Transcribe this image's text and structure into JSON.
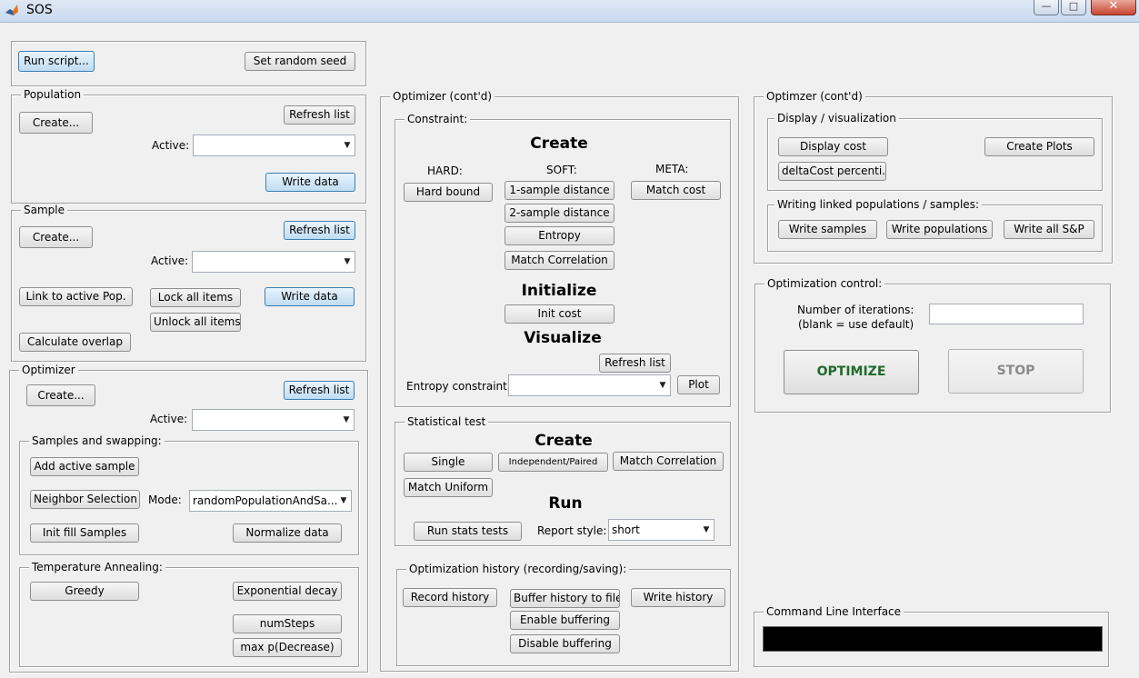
{
  "window": {
    "title": "SOS",
    "controls": {
      "minimize": "—",
      "maximize": "□",
      "close": "✕"
    }
  },
  "top": {
    "run_script": "Run script...",
    "set_seed": "Set random seed"
  },
  "population": {
    "title": "Population",
    "create": "Create...",
    "refresh": "Refresh list",
    "active_label": "Active:",
    "active_value": "",
    "write": "Write data"
  },
  "sample": {
    "title": "Sample",
    "create": "Create...",
    "refresh": "Refresh list",
    "active_label": "Active:",
    "active_value": "",
    "link": "Link to active Pop.",
    "lock": "Lock all items",
    "write": "Write data",
    "unlock": "Unlock all items",
    "overlap": "Calculate overlap"
  },
  "optimizer": {
    "title": "Optimizer",
    "create": "Create...",
    "refresh": "Refresh list",
    "active_label": "Active:",
    "active_value": "",
    "swapping": {
      "title": "Samples and swapping:",
      "add_active": "Add active sample",
      "neighbor": "Neighbor Selection",
      "mode_label": "Mode:",
      "mode_value": "randomPopulationAndSa...",
      "init_fill": "Init fill Samples",
      "normalize": "Normalize data"
    },
    "annealing": {
      "title": "Temperature Annealing:",
      "greedy": "Greedy",
      "exponential": "Exponential decay",
      "numsteps": "numSteps",
      "maxp": "max p(Decrease)"
    }
  },
  "optimizer_cont": {
    "title": "Optimizer (cont'd)",
    "constraint": {
      "title": "Constraint:",
      "create_heading": "Create",
      "hard_label": "HARD:",
      "soft_label": "SOFT:",
      "meta_label": "META:",
      "hard_bound": "Hard bound",
      "one_sample": "1-sample distance",
      "two_sample": "2-sample distance",
      "entropy": "Entropy",
      "match_corr": "Match Correlation",
      "match_cost": "Match cost",
      "init_heading": "Initialize",
      "init_cost": "Init cost",
      "vis_heading": "Visualize",
      "refresh": "Refresh list",
      "entropy_label": "Entropy constraint:",
      "entropy_value": "",
      "plot": "Plot"
    },
    "stat": {
      "title": "Statistical test",
      "create_heading": "Create",
      "single": "Single",
      "independent": "Independent/Paired",
      "match_corr": "Match Correlation",
      "match_uniform": "Match Uniform",
      "run_heading": "Run",
      "run_stats": "Run stats tests",
      "report_label": "Report style:",
      "report_value": "short"
    },
    "history": {
      "title": "Optimization history (recording/saving):",
      "record": "Record history",
      "buffer_file": "Buffer history to file",
      "write": "Write history",
      "enable": "Enable buffering",
      "disable": "Disable buffering"
    }
  },
  "optimizer_cont2": {
    "title": "Optimzer (cont'd)",
    "display": {
      "title": "Display / visualization",
      "display_cost": "Display cost",
      "create_plots": "Create Plots",
      "delta_cost": "deltaCost percenti..."
    },
    "writing": {
      "title": "Writing linked populations / samples:",
      "samples": "Write samples",
      "populations": "Write populations",
      "all": "Write all S&P"
    }
  },
  "opt_control": {
    "title": "Optimization control:",
    "iter_label_1": "Number of iterations:",
    "iter_label_2": "(blank = use default)",
    "iter_value": "",
    "optimize": "OPTIMIZE",
    "stop": "STOP"
  },
  "cli": {
    "title": "Command Line Interface"
  }
}
